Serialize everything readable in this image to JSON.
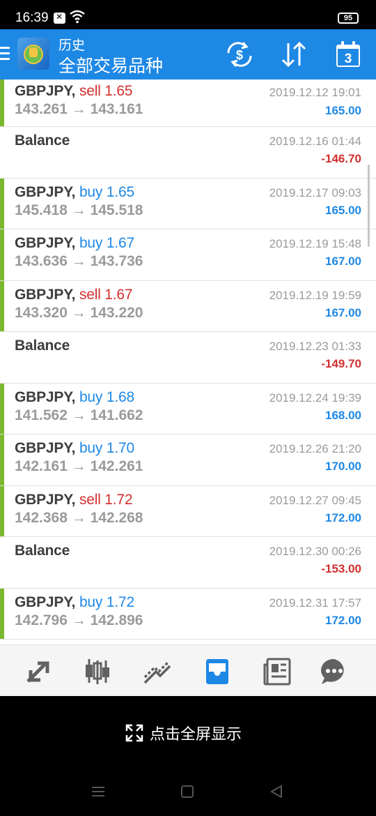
{
  "status_bar": {
    "time": "16:39",
    "battery": "95"
  },
  "header": {
    "subtitle": "历史",
    "title": "全部交易品种"
  },
  "trades": [
    {
      "type": "trade",
      "symbol": "GBPJPY,",
      "side": "sell",
      "lots": "sell 1.65",
      "prices": "143.261 → 143.161",
      "datetime": "2019.12.12 19:01",
      "amount": "165.00",
      "amount_sign": "pos"
    },
    {
      "type": "balance",
      "label": "Balance",
      "datetime": "2019.12.16 01:44",
      "amount": "-146.70",
      "amount_sign": "neg"
    },
    {
      "type": "trade",
      "symbol": "GBPJPY,",
      "side": "buy",
      "lots": "buy 1.65",
      "prices": "145.418 → 145.518",
      "datetime": "2019.12.17 09:03",
      "amount": "165.00",
      "amount_sign": "pos"
    },
    {
      "type": "trade",
      "symbol": "GBPJPY,",
      "side": "buy",
      "lots": "buy 1.67",
      "prices": "143.636 → 143.736",
      "datetime": "2019.12.19 15:48",
      "amount": "167.00",
      "amount_sign": "pos"
    },
    {
      "type": "trade",
      "symbol": "GBPJPY,",
      "side": "sell",
      "lots": "sell 1.67",
      "prices": "143.320 → 143.220",
      "datetime": "2019.12.19 19:59",
      "amount": "167.00",
      "amount_sign": "pos"
    },
    {
      "type": "balance",
      "label": "Balance",
      "datetime": "2019.12.23 01:33",
      "amount": "-149.70",
      "amount_sign": "neg"
    },
    {
      "type": "trade",
      "symbol": "GBPJPY,",
      "side": "buy",
      "lots": "buy 1.68",
      "prices": "141.562 → 141.662",
      "datetime": "2019.12.24 19:39",
      "amount": "168.00",
      "amount_sign": "pos"
    },
    {
      "type": "trade",
      "symbol": "GBPJPY,",
      "side": "buy",
      "lots": "buy 1.70",
      "prices": "142.161 → 142.261",
      "datetime": "2019.12.26 21:20",
      "amount": "170.00",
      "amount_sign": "pos"
    },
    {
      "type": "trade",
      "symbol": "GBPJPY,",
      "side": "sell",
      "lots": "sell 1.72",
      "prices": "142.368 → 142.268",
      "datetime": "2019.12.27 09:45",
      "amount": "172.00",
      "amount_sign": "pos"
    },
    {
      "type": "balance",
      "label": "Balance",
      "datetime": "2019.12.30 00:26",
      "amount": "-153.00",
      "amount_sign": "neg"
    },
    {
      "type": "trade",
      "symbol": "GBPJPY,",
      "side": "buy",
      "lots": "buy 1.72",
      "prices": "142.796 → 142.896",
      "datetime": "2019.12.31 17:57",
      "amount": "172.00",
      "amount_sign": "pos"
    }
  ],
  "bottom_nav": {
    "items": [
      "quotes-icon",
      "chart-icon",
      "trade-icon",
      "history-icon",
      "news-icon",
      "chat-icon"
    ],
    "active": "history-icon"
  },
  "fullscreen": {
    "label": "点击全屏显示"
  },
  "calendar_day": "3",
  "colors": {
    "accent": "#1e88e5",
    "buy": "#1e88e5",
    "sell": "#d32f2f",
    "profit_bar": "#7cb82f"
  }
}
